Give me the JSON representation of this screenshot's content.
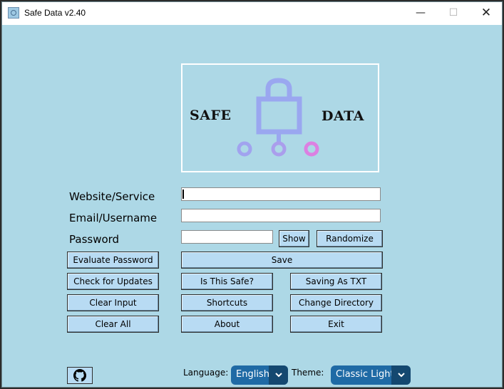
{
  "window": {
    "title": "Safe Data v2.40",
    "minimize": "—",
    "maximize": "☐",
    "close": "✕"
  },
  "logo": {
    "left_text": "SAFE",
    "right_text": "DATA"
  },
  "form": {
    "website_label": "Website/Service",
    "email_label": "Email/Username",
    "password_label": "Password",
    "website_value": "",
    "email_value": "",
    "password_value": ""
  },
  "buttons": {
    "show": "Show",
    "randomize": "Randomize",
    "evaluate_password": "Evaluate Password",
    "save": "Save",
    "check_updates": "Check for Updates",
    "is_this_safe": "Is This Safe?",
    "saving_as": "Saving As TXT",
    "clear_input": "Clear Input",
    "shortcuts": "Shortcuts",
    "change_directory": "Change Directory",
    "clear_all": "Clear All",
    "about": "About",
    "exit": "Exit"
  },
  "footer": {
    "language_label": "Language:",
    "language_value": "English",
    "theme_label": "Theme:",
    "theme_value": "Classic Light"
  },
  "icons": {
    "app": "app-logo-icon",
    "github": "github-icon",
    "dropdown": "chevron-down-icon",
    "logo_graphic": "padlock-network-icon"
  },
  "colors": {
    "background": "#add8e6",
    "button": "#b8dbf3",
    "dropdown": "#1f6aa5",
    "dropdown_arrow": "#144870",
    "lock_gradient_start": "#8fa2f0",
    "lock_gradient_end": "#e07fe0"
  }
}
